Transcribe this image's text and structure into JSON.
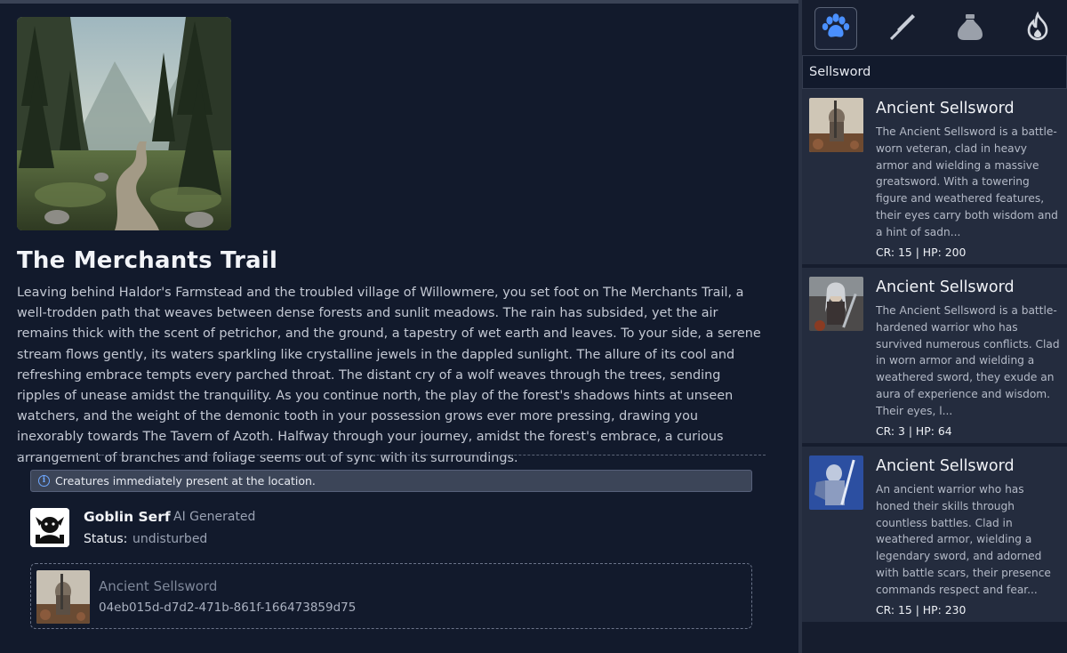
{
  "location": {
    "title": "The Merchants Trail",
    "description": "Leaving behind Haldor's Farmstead and the troubled village of Willowmere, you set foot on The Merchants Trail, a well-trodden path that weaves between dense forests and sunlit meadows. The rain has subsided, yet the air remains thick with the scent of petrichor, and the ground, a tapestry of wet earth and leaves. To your side, a serene stream flows gently, its waters sparkling like crystalline jewels in the dappled sunlight. The allure of its cool and refreshing embrace tempts every parched throat. The distant cry of a wolf weaves through the trees, sending ripples of unease amidst the tranquility. As you continue north, the play of the forest's shadows hints at unseen watchers, and the weight of the demonic tooth in your possession grows ever more pressing, drawing you inexorably towards The Tavern of Azoth. Halfway through your journey, amidst the forest's embrace, a curious arrangement of branches and foliage seems out of sync with its surroundings."
  },
  "notice": {
    "icon": "info-icon",
    "text": "Creatures immediately present at the location."
  },
  "creature": {
    "name": "Goblin Serf",
    "tag": "AI Generated",
    "status_label": "Status:",
    "status_value": "undisturbed"
  },
  "dropzone": {
    "name": "Ancient Sellsword",
    "id": "04eb015d-d7d2-471b-861f-166473859d75"
  },
  "sidebar": {
    "tabs": [
      {
        "icon": "paw-icon",
        "active": true
      },
      {
        "icon": "sword-icon",
        "active": false
      },
      {
        "icon": "pouch-icon",
        "active": false
      },
      {
        "icon": "fire-icon",
        "active": false
      }
    ],
    "search_value": "Sellsword",
    "results": [
      {
        "title": "Ancient Sellsword",
        "description": "The Ancient Sellsword is a battle-worn veteran, clad in heavy armor and wielding a massive greatsword. With a towering figure and weathered features, their eyes carry both wisdom and a hint of sadn...",
        "stats": "CR: 15 | HP: 200"
      },
      {
        "title": "Ancient Sellsword",
        "description": "The Ancient Sellsword is a battle-hardened warrior who has survived numerous conflicts. Clad in worn armor and wielding a weathered sword, they exude an aura of experience and wisdom. Their eyes, l...",
        "stats": "CR: 3 | HP: 64"
      },
      {
        "title": "Ancient Sellsword",
        "description": "An ancient warrior who has honed their skills through countless battles. Clad in weathered armor, wielding a legendary sword, and adorned with battle scars, their presence commands respect and fear...",
        "stats": "CR: 15 | HP: 230"
      }
    ]
  },
  "colors": {
    "background": "#121a2c",
    "card": "#242c3e",
    "accent_blue": "#4a90ff"
  }
}
